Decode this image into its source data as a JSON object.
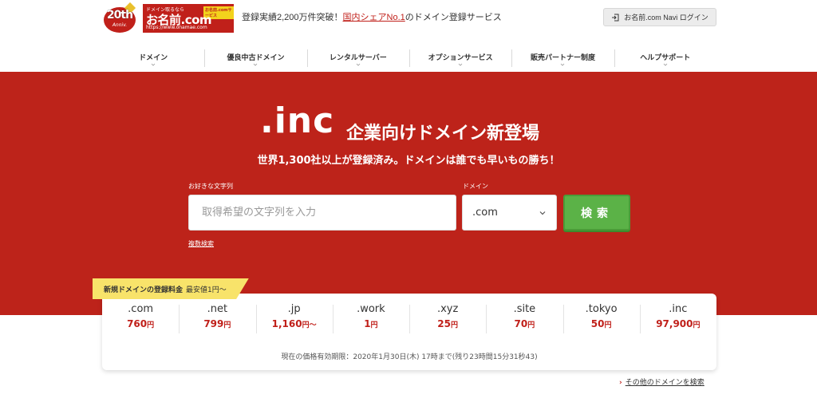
{
  "header": {
    "anniv_number": "20th",
    "anniv_sub": "Anniv.",
    "logo_tag": "ドメイン取るなら",
    "logo_badge": "お名前.comサービス",
    "logo_main": "お名前.com",
    "logo_url": "https://www.onamae.com",
    "tagline_prefix": "登録実績2,200万件突破！",
    "tagline_link": "国内シェアNo.1",
    "tagline_suffix": "のドメイン登録サービス",
    "navi_login_label": "お名前.com Navi ログイン"
  },
  "nav": {
    "items": [
      {
        "label": "ドメイン"
      },
      {
        "label": "優良中古ドメイン"
      },
      {
        "label": "レンタルサーバー"
      },
      {
        "label": "オプションサービス"
      },
      {
        "label": "販売パートナー制度"
      },
      {
        "label": "ヘルプサポート"
      }
    ]
  },
  "hero": {
    "logo_text": ".inc",
    "title": "企業向けドメイン新登場",
    "subtitle": "世界1,300社以上が登録済み。ドメインは誰でも早いもの勝ち！"
  },
  "search": {
    "input_label": "お好きな文字列",
    "input_placeholder": "取得希望の文字列を入力",
    "tld_label": "ドメイン",
    "tld_selected": ".com",
    "search_button": "検索",
    "multi_search_link": "複数検索"
  },
  "pricing": {
    "ribbon_bold": "新規ドメインの登録料金",
    "ribbon_rest": "最安値1円〜",
    "items": [
      {
        "tld": ".com",
        "price": "760",
        "unit": "円"
      },
      {
        "tld": ".net",
        "price": "799",
        "unit": "円"
      },
      {
        "tld": ".jp",
        "price": "1,160",
        "unit": "円〜"
      },
      {
        "tld": ".work",
        "price": "1",
        "unit": "円"
      },
      {
        "tld": ".xyz",
        "price": "25",
        "unit": "円"
      },
      {
        "tld": ".site",
        "price": "70",
        "unit": "円"
      },
      {
        "tld": ".tokyo",
        "price": "50",
        "unit": "円"
      },
      {
        "tld": ".inc",
        "price": "97,900",
        "unit": "円"
      }
    ],
    "note": "現在の価格有効期限：2020年1月30日(木) 17時まで(残り23時間15分31秒43)"
  },
  "other_link": {
    "arrow": "›",
    "label": "その他のドメインを検索"
  },
  "colors": {
    "brand_red": "#bd231a",
    "button_green": "#5bb247",
    "ribbon_yellow": "#f8e36a",
    "price_red": "#c0201a"
  }
}
